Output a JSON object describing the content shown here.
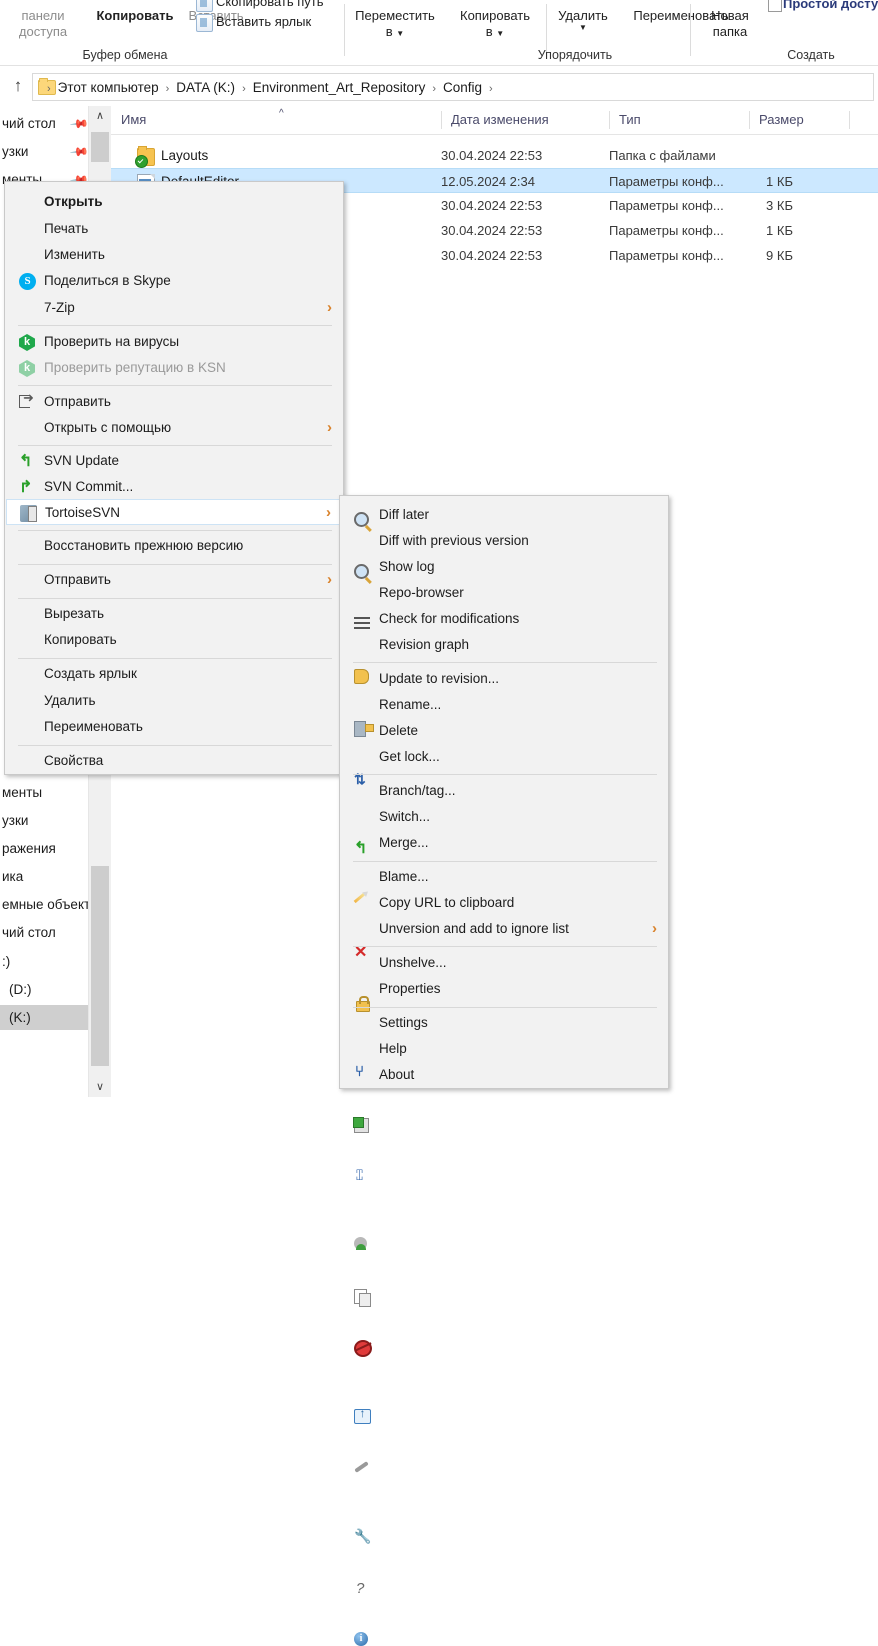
{
  "ribbon": {
    "groups": [
      {
        "caption": "Буфер обмена"
      },
      {
        "caption": "Упорядочить"
      },
      {
        "caption": "Создать"
      }
    ],
    "clipboard": {
      "panel_line1": "панели",
      "panel_line2": "доступа",
      "copy": "Копировать",
      "paste": "Вставить",
      "copy_path": "Скопировать путь",
      "paste_shortcut": "Вставить ярлык"
    },
    "organize": {
      "move_to_l1": "Переместить",
      "move_to_l2": "в",
      "copy_to_l1": "Копировать",
      "copy_to_l2": "в",
      "delete": "Удалить",
      "rename": "Переименовать"
    },
    "create": {
      "new_folder_l1": "Новая",
      "new_folder_l2": "папка"
    },
    "open_group": {
      "easy_access": "Простой доступ"
    }
  },
  "address": {
    "up_icon": "up-arrow-icon",
    "crumbs": [
      "Этот компьютер",
      "DATA (K:)",
      "Environment_Art_Repository",
      "Config"
    ],
    "separator": "›"
  },
  "navpane": {
    "items_top": [
      {
        "label": "чий стол",
        "pinned": true
      },
      {
        "label": "узки",
        "pinned": true
      },
      {
        "label": "менты",
        "pinned": true
      }
    ],
    "items_bottom": [
      {
        "label": "менты",
        "selected": false
      },
      {
        "label": "узки",
        "selected": false
      },
      {
        "label": "ражения",
        "selected": false
      },
      {
        "label": "ика",
        "selected": false
      },
      {
        "label": "емные объекты",
        "selected": false
      },
      {
        "label": "чий стол",
        "selected": false
      },
      {
        "label": ":)",
        "selected": false
      },
      {
        "label": "(D:)",
        "selected": false
      },
      {
        "label": "(K:)",
        "selected": true
      }
    ]
  },
  "filelist": {
    "columns": [
      "Имя",
      "Дата изменения",
      "Тип",
      "Размер"
    ],
    "sort_indicator": "^",
    "rows": [
      {
        "name": "Layouts",
        "date": "30.04.2024 22:53",
        "type": "Папка с файлами",
        "size": "",
        "icon": "folder-icon",
        "overlay": "svn-ok",
        "selected": false
      },
      {
        "name": "DefaultEditor",
        "date": "12.05.2024 2:34",
        "type": "Параметры конф...",
        "size": "1 КБ",
        "icon": "config-file-icon",
        "overlay": "svn-ok",
        "selected": true
      },
      {
        "name": "",
        "date": "30.04.2024 22:53",
        "type": "Параметры конф...",
        "size": "3 КБ",
        "icon": "config-file-icon",
        "overlay": "svn-ok",
        "selected": false
      },
      {
        "name": "",
        "date": "30.04.2024 22:53",
        "type": "Параметры конф...",
        "size": "1 КБ",
        "icon": "config-file-icon",
        "overlay": "svn-ok",
        "selected": false
      },
      {
        "name": "",
        "date": "30.04.2024 22:53",
        "type": "Параметры конф...",
        "size": "9 КБ",
        "icon": "config-file-icon",
        "overlay": "svn-ok",
        "selected": false
      }
    ]
  },
  "context_menu": {
    "items": [
      {
        "label": "Открыть",
        "bold": true,
        "icon": null,
        "submenu": false,
        "disabled": false
      },
      {
        "label": "Печать",
        "bold": false,
        "icon": null,
        "submenu": false,
        "disabled": false
      },
      {
        "label": "Изменить",
        "bold": false,
        "icon": null,
        "submenu": false,
        "disabled": false
      },
      {
        "label": "Поделиться в Skype",
        "bold": false,
        "icon": "skype-icon",
        "submenu": false,
        "disabled": false
      },
      {
        "label": "7-Zip",
        "bold": false,
        "icon": null,
        "submenu": true,
        "disabled": false
      },
      {
        "label": "Проверить на вирусы",
        "bold": false,
        "icon": "kaspersky-icon",
        "submenu": false,
        "disabled": false
      },
      {
        "label": "Проверить репутацию в KSN",
        "bold": false,
        "icon": "kaspersky-icon",
        "submenu": false,
        "disabled": true
      },
      {
        "label": "Отправить",
        "bold": false,
        "icon": "share-icon",
        "submenu": false,
        "disabled": false
      },
      {
        "label": "Открыть с помощью",
        "bold": false,
        "icon": null,
        "submenu": true,
        "disabled": false
      },
      {
        "label": "SVN Update",
        "bold": false,
        "icon": "svn-update-icon",
        "submenu": false,
        "disabled": false
      },
      {
        "label": "SVN Commit...",
        "bold": false,
        "icon": "svn-commit-icon",
        "submenu": false,
        "disabled": false
      },
      {
        "label": "TortoiseSVN",
        "bold": false,
        "icon": "tortoisesvn-icon",
        "submenu": true,
        "disabled": false,
        "highlighted": true
      },
      {
        "label": "Восстановить прежнюю версию",
        "bold": false,
        "icon": null,
        "submenu": false,
        "disabled": false
      },
      {
        "label": "Отправить",
        "bold": false,
        "icon": null,
        "submenu": true,
        "disabled": false
      },
      {
        "label": "Вырезать",
        "bold": false,
        "icon": null,
        "submenu": false,
        "disabled": false
      },
      {
        "label": "Копировать",
        "bold": false,
        "icon": null,
        "submenu": false,
        "disabled": false
      },
      {
        "label": "Создать ярлык",
        "bold": false,
        "icon": null,
        "submenu": false,
        "disabled": false
      },
      {
        "label": "Удалить",
        "bold": false,
        "icon": null,
        "submenu": false,
        "disabled": false
      },
      {
        "label": "Переименовать",
        "bold": false,
        "icon": null,
        "submenu": false,
        "disabled": false
      },
      {
        "label": "Свойства",
        "bold": false,
        "icon": null,
        "submenu": false,
        "disabled": false
      }
    ]
  },
  "submenu": {
    "items": [
      {
        "label": "Diff later",
        "icon": "diff-later-icon",
        "submenu": false
      },
      {
        "label": "Diff with previous version",
        "icon": "diff-icon",
        "submenu": false
      },
      {
        "label": "Show log",
        "icon": "show-log-icon",
        "submenu": false
      },
      {
        "label": "Repo-browser",
        "icon": "repo-browser-icon",
        "submenu": false
      },
      {
        "label": "Check for modifications",
        "icon": "check-modifications-icon",
        "submenu": false
      },
      {
        "label": "Revision graph",
        "icon": "revision-graph-icon",
        "submenu": false
      },
      {
        "label": "Update to revision...",
        "icon": "update-icon",
        "submenu": false
      },
      {
        "label": "Rename...",
        "icon": "rename-pencil-icon",
        "submenu": false
      },
      {
        "label": "Delete",
        "icon": "delete-x-icon",
        "submenu": false
      },
      {
        "label": "Get lock...",
        "icon": "lock-icon",
        "submenu": false
      },
      {
        "label": "Branch/tag...",
        "icon": "branch-icon",
        "submenu": false
      },
      {
        "label": "Switch...",
        "icon": "switch-icon",
        "submenu": false
      },
      {
        "label": "Merge...",
        "icon": "merge-icon",
        "submenu": false
      },
      {
        "label": "Blame...",
        "icon": "blame-icon",
        "submenu": false
      },
      {
        "label": "Copy URL to clipboard",
        "icon": "copy-url-icon",
        "submenu": false
      },
      {
        "label": "Unversion and add to ignore list",
        "icon": "unversion-icon",
        "submenu": true
      },
      {
        "label": "Unshelve...",
        "icon": "unshelve-icon",
        "submenu": false
      },
      {
        "label": "Properties",
        "icon": "properties-icon",
        "submenu": false
      },
      {
        "label": "Settings",
        "icon": "settings-icon",
        "submenu": false
      },
      {
        "label": "Help",
        "icon": "help-icon",
        "submenu": false
      },
      {
        "label": "About",
        "icon": "about-icon",
        "submenu": false
      }
    ]
  },
  "colors": {
    "selection": "#cce8ff",
    "menu_bg": "#f2f2f2",
    "column_header_text": "#4a4a6a",
    "submenu_arrow": "#d9822b"
  }
}
